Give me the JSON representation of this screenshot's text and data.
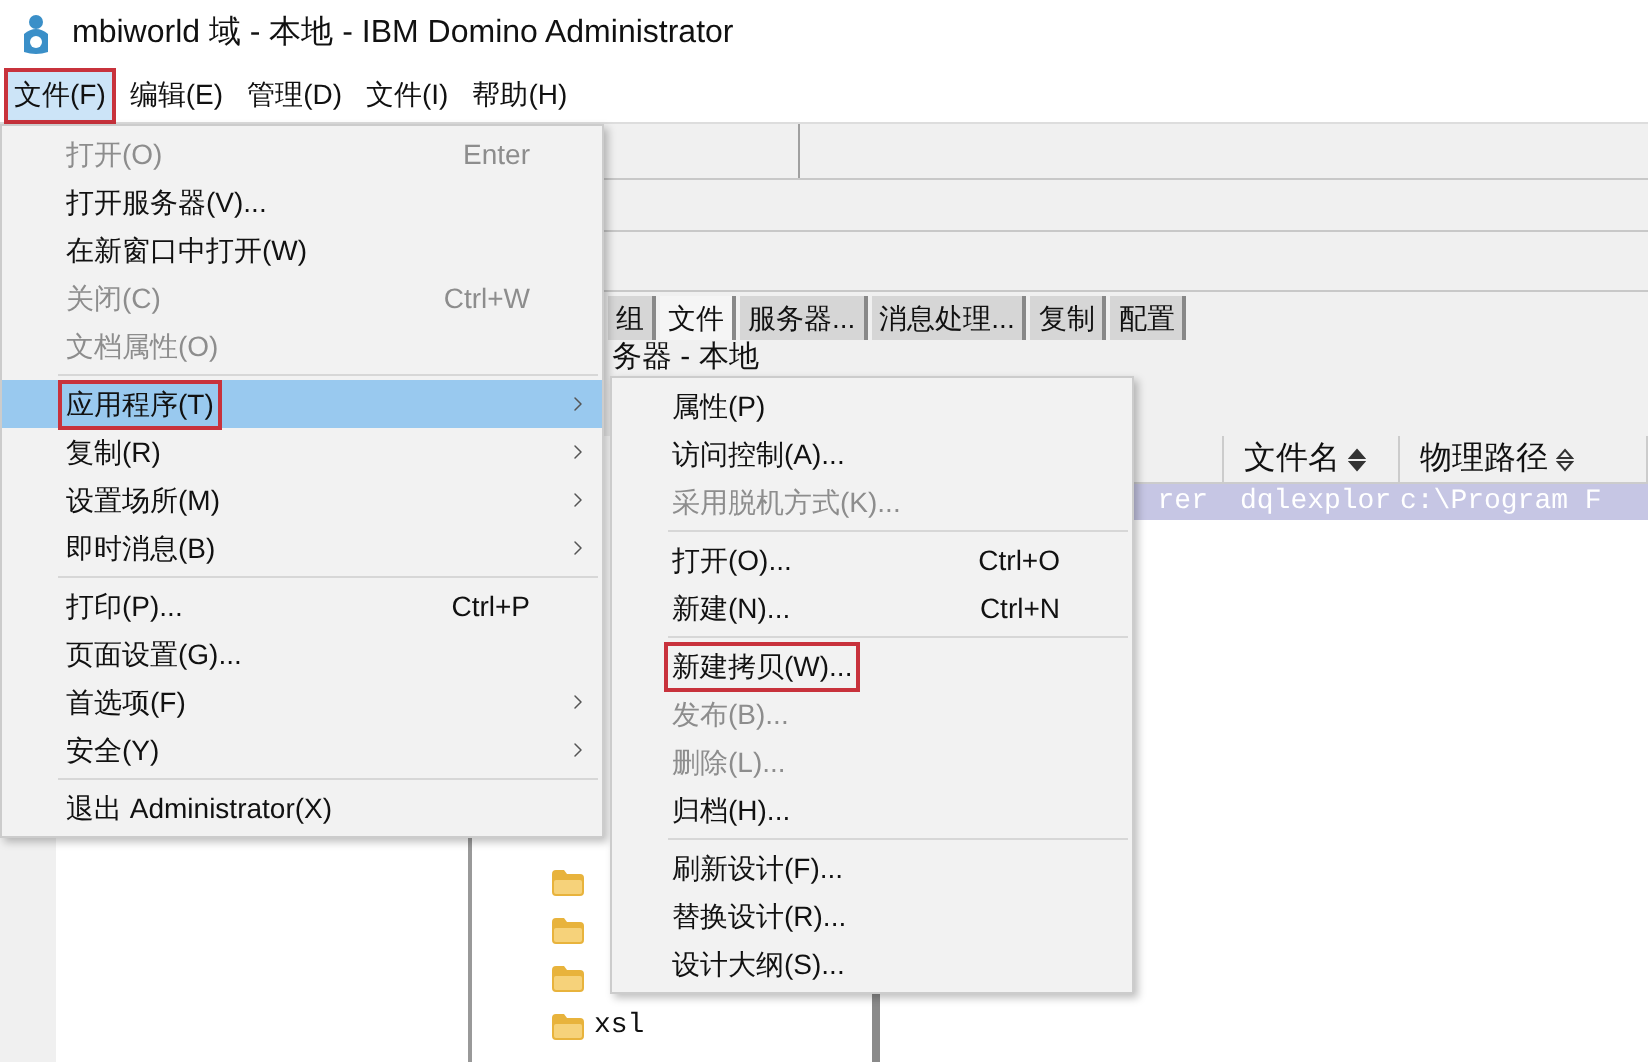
{
  "window": {
    "title": "mbiworld 域 - 本地 - IBM Domino Administrator"
  },
  "menu_bar": [
    {
      "label": "文件(F)",
      "selected": true,
      "annotated": true
    },
    {
      "label": "编辑(E)",
      "selected": false,
      "annotated": false
    },
    {
      "label": "管理(D)",
      "selected": false,
      "annotated": false
    },
    {
      "label": "文件(I)",
      "selected": false,
      "annotated": false
    },
    {
      "label": "帮助(H)",
      "selected": false,
      "annotated": false
    }
  ],
  "tabs": [
    {
      "label": "组",
      "selected": false
    },
    {
      "label": "文件",
      "selected": true
    },
    {
      "label": "服务器...",
      "selected": false
    },
    {
      "label": "消息处理...",
      "selected": false
    },
    {
      "label": "复制",
      "selected": false
    },
    {
      "label": "配置",
      "selected": false
    }
  ],
  "view_title": "务器 - 本地",
  "tree": [
    {
      "kind": "folder"
    },
    {
      "kind": "folder"
    },
    {
      "kind": "folder"
    },
    {
      "kind": "folder",
      "label": "xsl"
    }
  ],
  "table": {
    "columns": [
      {
        "kind": "blank"
      },
      {
        "kind": "text",
        "label": "文件名",
        "sorted": true
      },
      {
        "kind": "text",
        "label": "物理路径",
        "sorted": false
      }
    ],
    "rows": [
      {
        "cells": [
          "rer",
          "dqlexplor",
          "c:\\Program F"
        ],
        "selected": true
      }
    ]
  },
  "file_menu": {
    "items": [
      {
        "kind": "item",
        "label": "打开(O)",
        "shortcut": "Enter",
        "disabled": true,
        "has_submenu": false,
        "selected": false,
        "annotated": false
      },
      {
        "kind": "item",
        "label": "打开服务器(V)...",
        "disabled": false,
        "has_submenu": false,
        "selected": false,
        "annotated": false
      },
      {
        "kind": "item",
        "label": "在新窗口中打开(W)",
        "disabled": false,
        "has_submenu": false,
        "selected": false,
        "annotated": false
      },
      {
        "kind": "item",
        "label": "关闭(C)",
        "shortcut": "Ctrl+W",
        "disabled": true,
        "has_submenu": false,
        "selected": false,
        "annotated": false
      },
      {
        "kind": "item",
        "label": "文档属性(O)",
        "disabled": true,
        "has_submenu": false,
        "selected": false,
        "annotated": false
      },
      {
        "kind": "separator"
      },
      {
        "kind": "item",
        "label": "应用程序(T)",
        "disabled": false,
        "has_submenu": true,
        "selected": true,
        "annotated": true
      },
      {
        "kind": "item",
        "label": "复制(R)",
        "disabled": false,
        "has_submenu": true,
        "selected": false,
        "annotated": false
      },
      {
        "kind": "item",
        "label": "设置场所(M)",
        "disabled": false,
        "has_submenu": true,
        "selected": false,
        "annotated": false
      },
      {
        "kind": "item",
        "label": "即时消息(B)",
        "disabled": false,
        "has_submenu": true,
        "selected": false,
        "annotated": false
      },
      {
        "kind": "separator"
      },
      {
        "kind": "item",
        "label": "打印(P)...",
        "shortcut": "Ctrl+P",
        "disabled": false,
        "has_submenu": false,
        "selected": false,
        "annotated": false
      },
      {
        "kind": "item",
        "label": "页面设置(G)...",
        "disabled": false,
        "has_submenu": false,
        "selected": false,
        "annotated": false
      },
      {
        "kind": "item",
        "label": "首选项(F)",
        "disabled": false,
        "has_submenu": true,
        "selected": false,
        "annotated": false
      },
      {
        "kind": "item",
        "label": "安全(Y)",
        "disabled": false,
        "has_submenu": true,
        "selected": false,
        "annotated": false
      },
      {
        "kind": "separator"
      },
      {
        "kind": "item",
        "label": "退出 Administrator(X)",
        "disabled": false,
        "has_submenu": false,
        "selected": false,
        "annotated": false
      }
    ]
  },
  "submenu": {
    "items": [
      {
        "kind": "item",
        "label": "属性(P)",
        "disabled": false,
        "has_submenu": false,
        "selected": false,
        "annotated": false
      },
      {
        "kind": "item",
        "label": "访问控制(A)...",
        "disabled": false,
        "has_submenu": false,
        "selected": false,
        "annotated": false
      },
      {
        "kind": "item",
        "label": "采用脱机方式(K)...",
        "disabled": true,
        "has_submenu": false,
        "selected": false,
        "annotated": false
      },
      {
        "kind": "separator"
      },
      {
        "kind": "item",
        "label": "打开(O)...",
        "shortcut": "Ctrl+O",
        "disabled": false,
        "has_submenu": false,
        "selected": false,
        "annotated": false
      },
      {
        "kind": "item",
        "label": "新建(N)...",
        "shortcut": "Ctrl+N",
        "disabled": false,
        "has_submenu": false,
        "selected": false,
        "annotated": false
      },
      {
        "kind": "separator"
      },
      {
        "kind": "item",
        "label": "新建拷贝(W)...",
        "disabled": false,
        "has_submenu": false,
        "selected": false,
        "annotated": true
      },
      {
        "kind": "item",
        "label": "发布(B)...",
        "disabled": true,
        "has_submenu": false,
        "selected": false,
        "annotated": false
      },
      {
        "kind": "item",
        "label": "删除(L)...",
        "disabled": true,
        "has_submenu": false,
        "selected": false,
        "annotated": false
      },
      {
        "kind": "item",
        "label": "归档(H)...",
        "disabled": false,
        "has_submenu": false,
        "selected": false,
        "annotated": false
      },
      {
        "kind": "separator"
      },
      {
        "kind": "item",
        "label": "刷新设计(F)...",
        "disabled": false,
        "has_submenu": false,
        "selected": false,
        "annotated": false
      },
      {
        "kind": "item",
        "label": "替换设计(R)...",
        "disabled": false,
        "has_submenu": false,
        "selected": false,
        "annotated": false
      },
      {
        "kind": "item",
        "label": "设计大纲(S)...",
        "disabled": false,
        "has_submenu": false,
        "selected": false,
        "annotated": false
      }
    ]
  }
}
